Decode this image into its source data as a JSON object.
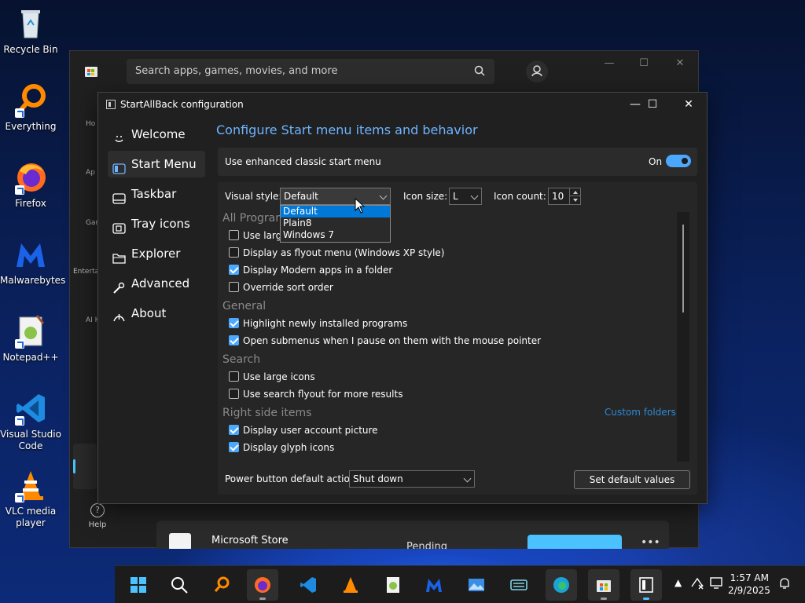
{
  "desktop": {
    "icons": [
      {
        "label": "Recycle Bin"
      },
      {
        "label": "Everything"
      },
      {
        "label": "Firefox"
      },
      {
        "label": "Malwarebytes"
      },
      {
        "label": "Notepad++"
      },
      {
        "label": "Visual Studio Code"
      },
      {
        "label": "VLC media player"
      }
    ]
  },
  "store": {
    "search_placeholder": "Search apps, games, movies, and more",
    "nav": [
      "Ho",
      "Ap",
      "Gam",
      "Enterta",
      "AI H"
    ],
    "help_label": "Help",
    "card_name": "Microsoft Store",
    "card_status": "Pending",
    "card_more": "•••"
  },
  "config": {
    "title": "StartAllBack configuration",
    "sidebar": [
      {
        "label": "Welcome",
        "icon": "smile-icon"
      },
      {
        "label": "Start Menu",
        "icon": "start-menu-icon"
      },
      {
        "label": "Taskbar",
        "icon": "taskbar-icon"
      },
      {
        "label": "Tray icons",
        "icon": "tray-icon"
      },
      {
        "label": "Explorer",
        "icon": "folder-icon"
      },
      {
        "label": "Advanced",
        "icon": "wrench-icon"
      },
      {
        "label": "About",
        "icon": "about-icon"
      }
    ],
    "heading": "Configure Start menu items and behavior",
    "enhanced_label": "Use enhanced classic start menu",
    "enhanced_state": "On",
    "visual_style_label": "Visual style:",
    "visual_style_value": "Default",
    "visual_style_options": [
      "Default",
      "Plain8",
      "Windows 7"
    ],
    "icon_size_label": "Icon size:",
    "icon_size_value": "L",
    "icon_count_label": "Icon count:",
    "icon_count_value": "10",
    "sections": {
      "all_programs": "All Programs",
      "general": "General",
      "search": "Search",
      "right_side": "Right side items"
    },
    "options": [
      {
        "label": "Use large icons",
        "checked": false
      },
      {
        "label": "Display as flyout menu (Windows XP style)",
        "checked": false
      },
      {
        "label": "Display Modern apps in a folder",
        "checked": true
      },
      {
        "label": "Override sort order",
        "checked": false
      },
      {
        "label": "Highlight newly installed programs",
        "checked": true
      },
      {
        "label": "Open submenus when I pause on them with the mouse pointer",
        "checked": true
      },
      {
        "label": "Use large icons",
        "checked": false
      },
      {
        "label": "Use search flyout for more results",
        "checked": false
      },
      {
        "label": "Display user account picture",
        "checked": true
      },
      {
        "label": "Display glyph icons",
        "checked": true
      }
    ],
    "custom_folders": "Custom folders...",
    "power_label": "Power button default action:",
    "power_value": "Shut down",
    "set_default": "Set default values"
  },
  "taskbar": {
    "time": "1:57 AM",
    "date": "2/9/2025"
  },
  "colors": {
    "accent": "#4ca8ff",
    "heading": "#6fb4ff",
    "link": "#2d8ad8",
    "selection": "#0078d7"
  }
}
